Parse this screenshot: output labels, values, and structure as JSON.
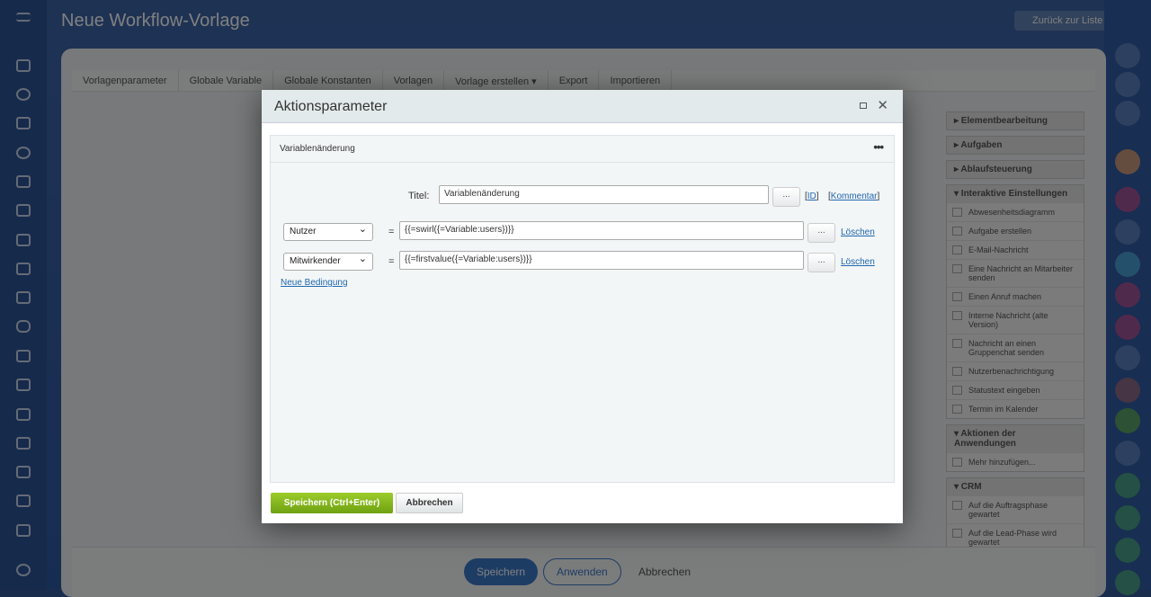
{
  "header": {
    "title": "Neue Workflow-Vorlage",
    "back_label": "Zurück zur Liste"
  },
  "tabs": [
    "Vorlagenparameter",
    "Globale Variable",
    "Globale Konstanten",
    "Vorlagen",
    "Vorlage erstellen ▾",
    "Export",
    "Importieren"
  ],
  "panel": {
    "groups": [
      {
        "title": "▸ Elementbearbeitung",
        "items": []
      },
      {
        "title": "▸ Aufgaben",
        "items": []
      },
      {
        "title": "▸ Ablaufsteuerung",
        "items": []
      },
      {
        "title": "▾ Interaktive Einstellungen",
        "items": [
          "Abwesenheitsdiagramm",
          "Aufgabe erstellen",
          "E-Mail-Nachricht",
          "Eine Nachricht an Mitarbeiter senden",
          "Einen Anruf machen",
          "Interne Nachricht (alte Version)",
          "Nachricht an einen Gruppenchat senden",
          "Nutzerbenachrichtigung",
          "Statustext eingeben",
          "Termin im Kalender"
        ]
      },
      {
        "title": "▾ Aktionen der Anwendungen",
        "items": [
          "Mehr hinzufügen..."
        ]
      },
      {
        "title": "▾ CRM",
        "items": [
          "Auf die Auftragsphase gewartet",
          "Auf die Lead-Phase wird gewartet"
        ]
      }
    ]
  },
  "footer": {
    "save": "Speichern",
    "apply": "Anwenden",
    "cancel": "Abbrechen"
  },
  "dialog": {
    "title": "Aktionsparameter",
    "section_title": "Variablenänderung",
    "titel_label": "Titel:",
    "titel_value": "Variablenänderung",
    "dots": "...",
    "id_link": "ID",
    "comment_link": "Kommentar",
    "conditions": [
      {
        "variable": "Nutzer",
        "eq": "=",
        "value": "{{=swirl({=Variable:users})}}",
        "delete": "Löschen"
      },
      {
        "variable": "Mitwirkender",
        "eq": "=",
        "value": "{{=firstvalue({=Variable:users})}}",
        "delete": "Löschen"
      }
    ],
    "new_condition": "Neue Bedingung",
    "save": "Speichern (Ctrl+Enter)",
    "cancel": "Abbrechen"
  }
}
